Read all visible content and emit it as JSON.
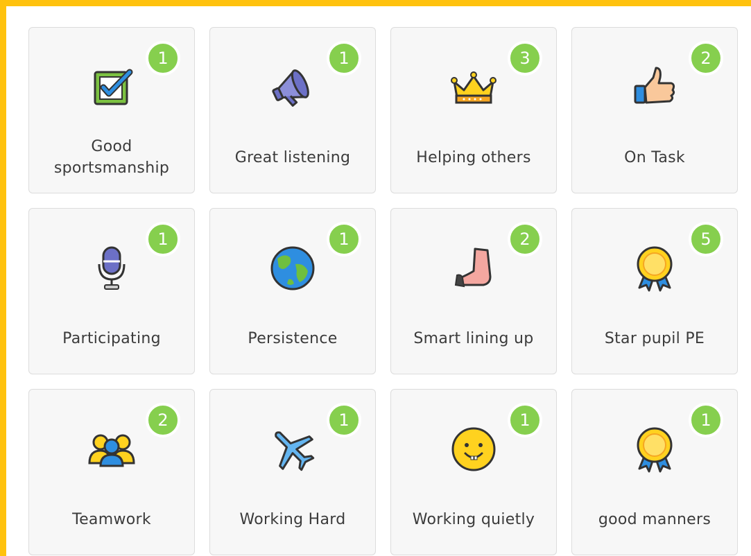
{
  "cards": [
    {
      "label": "Good sportsmanship",
      "count": "1",
      "icon": "checkbox-icon"
    },
    {
      "label": "Great listening",
      "count": "1",
      "icon": "megaphone-icon"
    },
    {
      "label": "Helping others",
      "count": "3",
      "icon": "crown-icon"
    },
    {
      "label": "On Task",
      "count": "2",
      "icon": "thumbs-up-icon"
    },
    {
      "label": "Participating",
      "count": "1",
      "icon": "microphone-icon"
    },
    {
      "label": "Persistence",
      "count": "1",
      "icon": "globe-icon"
    },
    {
      "label": "Smart lining up",
      "count": "2",
      "icon": "foot-icon"
    },
    {
      "label": "Star pupil PE",
      "count": "5",
      "icon": "award-ribbon-icon"
    },
    {
      "label": "Teamwork",
      "count": "2",
      "icon": "team-icon"
    },
    {
      "label": "Working Hard",
      "count": "1",
      "icon": "airplane-icon"
    },
    {
      "label": "Working quietly",
      "count": "1",
      "icon": "smiley-icon"
    },
    {
      "label": "good manners",
      "count": "1",
      "icon": "award-ribbon-icon"
    }
  ],
  "colors": {
    "frame": "#ffc20e",
    "badge": "#86cf4e",
    "card_bg": "#f7f7f7"
  }
}
